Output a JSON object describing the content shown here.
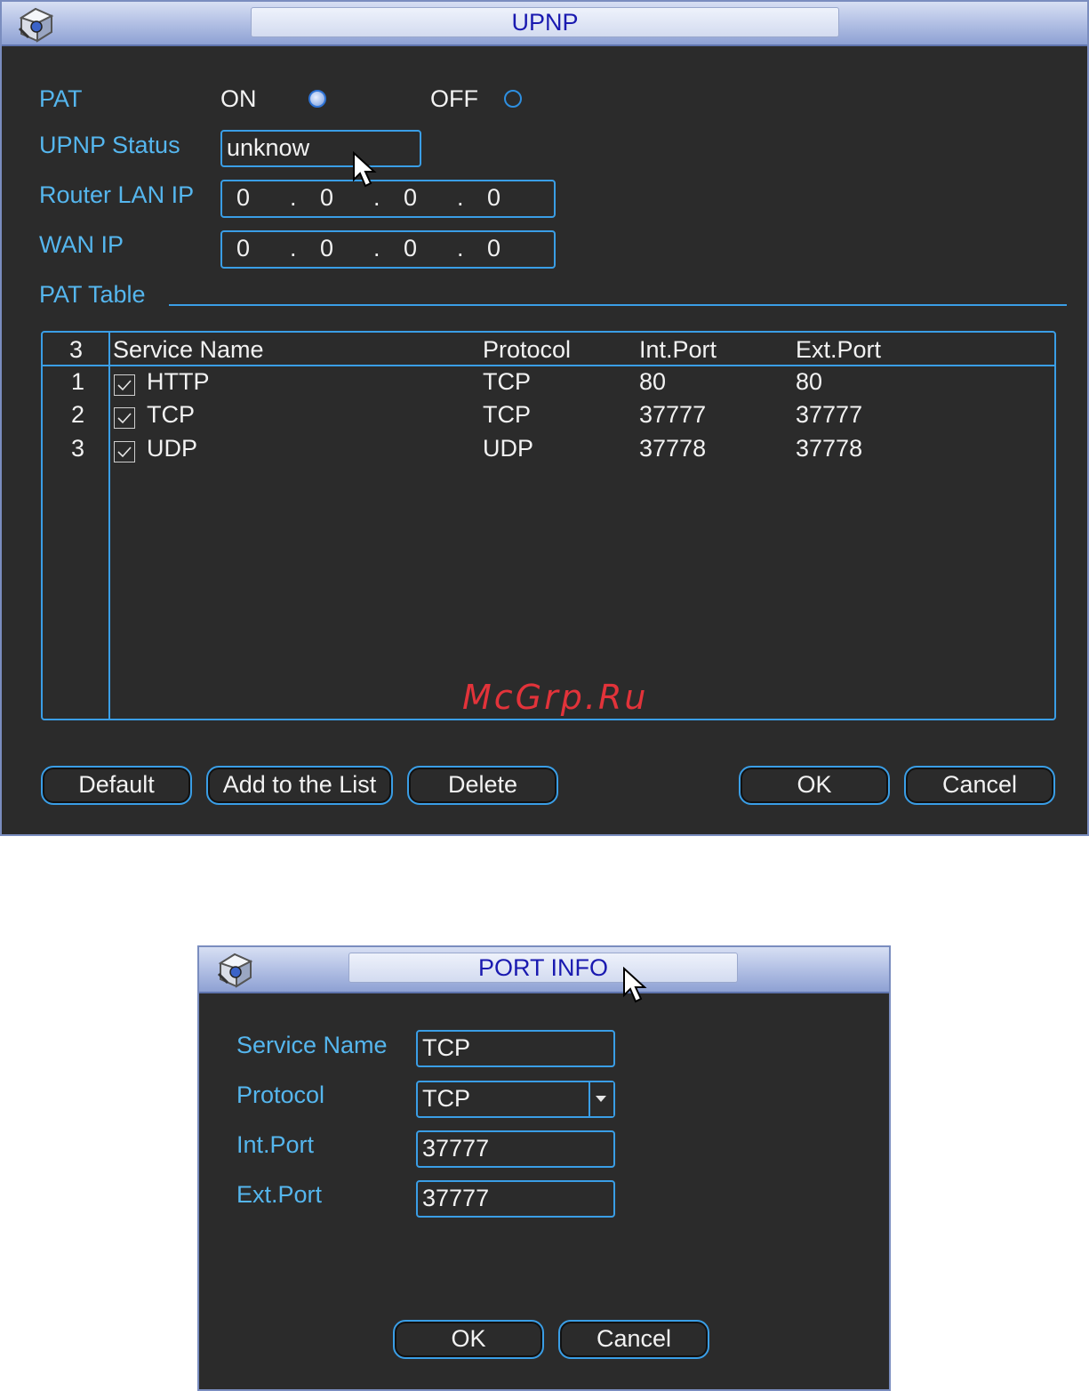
{
  "upnp": {
    "title": "UPNP",
    "pat_label": "PAT",
    "pat_on_label": "ON",
    "pat_off_label": "OFF",
    "pat_selected": "ON",
    "status_label": "UPNP Status",
    "status_value": "unknow",
    "router_ip_label": "Router LAN IP",
    "router_ip": [
      "0",
      "0",
      "0",
      "0"
    ],
    "wan_ip_label": "WAN IP",
    "wan_ip": [
      "0",
      "0",
      "0",
      "0"
    ],
    "ip_dot": ".",
    "pat_table_title": "PAT Table",
    "table": {
      "count": "3",
      "headers": [
        "Service Name",
        "Protocol",
        "Int.Port",
        "Ext.Port"
      ],
      "rows": [
        {
          "index": "1",
          "checked": true,
          "service": "HTTP",
          "protocol": "TCP",
          "int_port": "80",
          "ext_port": "80"
        },
        {
          "index": "2",
          "checked": true,
          "service": "TCP",
          "protocol": "TCP",
          "int_port": "37777",
          "ext_port": "37777"
        },
        {
          "index": "3",
          "checked": true,
          "service": "UDP",
          "protocol": "UDP",
          "int_port": "37778",
          "ext_port": "37778"
        }
      ]
    },
    "buttons": {
      "default": "Default",
      "add": "Add to the List",
      "delete": "Delete",
      "ok": "OK",
      "cancel": "Cancel"
    },
    "watermark": "McGrp.Ru"
  },
  "port_info": {
    "title": "PORT INFO",
    "service_name_label": "Service Name",
    "service_name_value": "TCP",
    "protocol_label": "Protocol",
    "protocol_value": "TCP",
    "int_port_label": "Int.Port",
    "int_port_value": "37777",
    "ext_port_label": "Ext.Port",
    "ext_port_value": "37777",
    "buttons": {
      "ok": "OK",
      "cancel": "Cancel"
    }
  },
  "colors": {
    "panel_bg": "#2b2b2b",
    "accent": "#3a9ee6",
    "label": "#55b6ee",
    "title_text": "#1a1ab0"
  },
  "icons": [
    "app-logo-icon",
    "radio-selected-icon",
    "radio-unselected-icon",
    "checkbox-checked-icon",
    "dropdown-arrow-icon",
    "mouse-pointer-icon"
  ]
}
